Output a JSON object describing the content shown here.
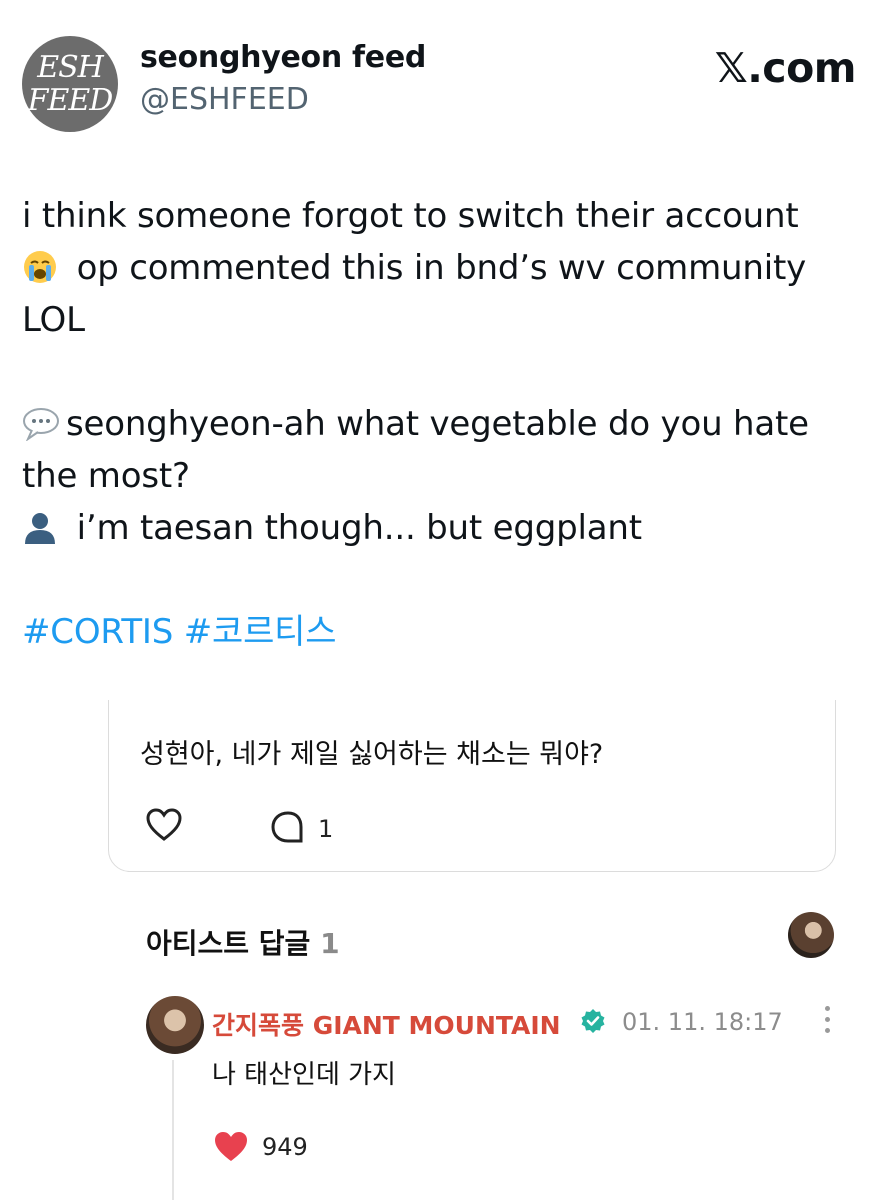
{
  "header": {
    "avatar_line1": "ESH",
    "avatar_line2": "FEED",
    "name": "seonghyeon feed",
    "handle": "@ESHFEED",
    "brand": "𝕏.com"
  },
  "tweet": {
    "line1": "i think someone forgot to switch their account",
    "line2": "op commented this in bnd’s wv community",
    "line3": "LOL",
    "line4": "seonghyeon-ah what vegetable do you hate",
    "line5": "the most?",
    "line6": "i’m taesan though... but eggplant",
    "hashtags": "#CORTIS #코르티스",
    "icons": [
      "loudly-crying-face-emoji",
      "speech-bubble-emoji",
      "bust-silhouette-emoji"
    ],
    "hashtag_color": "#1d9bf0"
  },
  "screenshot": {
    "question": "성현아, 네가 제일 싫어하는 채소는 뭐야?",
    "comment_count": "1",
    "artist_reply_title": "아티스트 답글",
    "artist_reply_count": "1",
    "reply_name": "간지폭풍 GIANT MOUNTAIN",
    "reply_time": "01. 11. 18:17",
    "reply_text": "나 태산인데 가지",
    "likes": "949",
    "name_color": "#d64a3a",
    "heart_color": "#e8414f"
  }
}
